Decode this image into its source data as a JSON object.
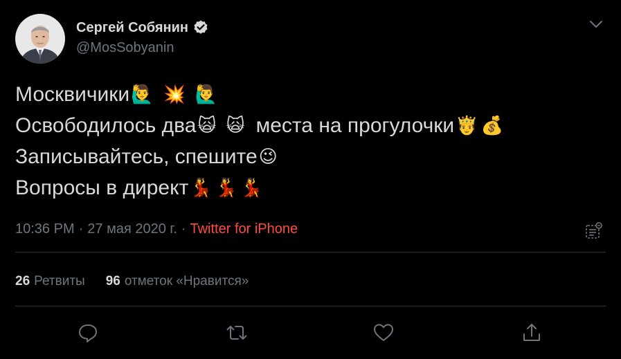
{
  "author": {
    "name": "Сергей Собянин",
    "handle": "@MosSobyanin",
    "verified": true
  },
  "tweet": {
    "lines": [
      {
        "text": "Москвичики",
        "emoji": [
          "🙋‍♂️",
          "💥",
          "🙋‍♂️"
        ]
      },
      {
        "text": "Освободилось два",
        "emoji": [
          "🙀",
          "🙀"
        ],
        "text2": "места на прогулочки",
        "emoji2": [
          "🤴",
          "💰"
        ]
      },
      {
        "text": "Записывайтесь, спешите",
        "emoji": [
          "😉"
        ]
      },
      {
        "text": "Вопросы в директ",
        "emoji": [
          "💃",
          "💃",
          "💃"
        ]
      }
    ]
  },
  "meta": {
    "time": "10:36 PM",
    "sep1": "·",
    "date": "27 мая 2020 г.",
    "sep2": "·",
    "source": "Twitter for iPhone"
  },
  "stats": {
    "retweets_count": "26",
    "retweets_label": "Ретвиты",
    "likes_count": "96",
    "likes_label": "отметок «Нравится»"
  },
  "icons": {
    "chevron": "chevron-down-icon",
    "verified": "verified-badge-icon",
    "analytics": "analytics-icon",
    "reply": "reply-icon",
    "retweet": "retweet-icon",
    "like": "heart-icon",
    "share": "share-icon"
  },
  "colors": {
    "background": "#000000",
    "text": "#d9d9d9",
    "secondary": "#6e767d",
    "source_link": "#ff4d3d",
    "divider": "#2f3336"
  }
}
